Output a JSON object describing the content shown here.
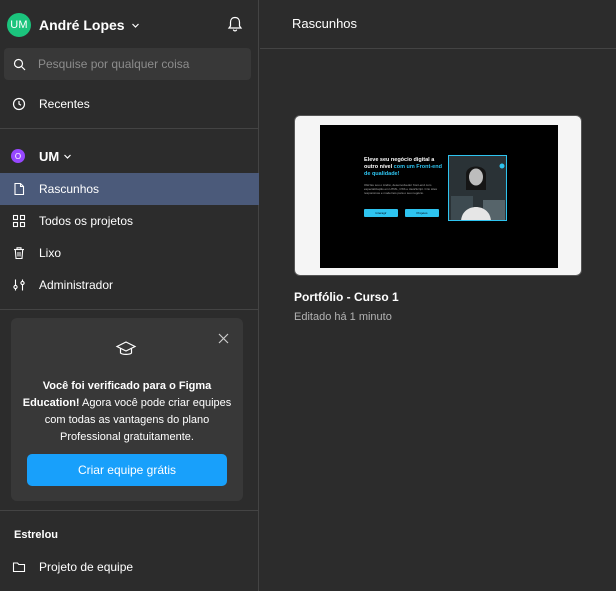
{
  "user": {
    "initials": "UM",
    "name": "André Lopes",
    "avatar_color": "#1bc47d"
  },
  "search": {
    "placeholder": "Pesquise por qualquer coisa"
  },
  "nav_top": {
    "recent_label": "Recentes"
  },
  "team": {
    "badge": "O",
    "name": "UM",
    "badge_color": "#9747ff"
  },
  "nav": {
    "drafts_label": "Rascunhos",
    "all_projects_label": "Todos os projetos",
    "trash_label": "Lixo",
    "admin_label": "Administrador"
  },
  "promo": {
    "text_bold": "Você foi verificado para o Figma Education!",
    "text_rest": " Agora você pode criar equipes com todas as vantagens do plano Professional gratuitamente.",
    "button_label": "Criar equipe grátis",
    "button_color": "#18a0fb"
  },
  "starred": {
    "section_label": "Estrelou",
    "item_label": "Projeto de equipe"
  },
  "main": {
    "title": "Rascunhos",
    "file": {
      "name": "Portfólio - Curso 1",
      "meta": "Editado há 1 minuto"
    },
    "thumbnail": {
      "headline_1": "Eleve seu negócio digital a outro nível",
      "headline_2": " com um Front-end de qualidade!",
      "body": "Olá! Eu sou o André, desenvolvedor front-end com especialização em HTML, CSS e JavaScript. Crio sites responsivos e modernos para o seu negócio.",
      "btn1": "Interagir",
      "btn2": "Projetos",
      "accent": "#2ec4f0"
    }
  },
  "colors": {
    "sidebar_bg": "#2c2c2c",
    "active_item": "#4b5a7a",
    "divider": "#444444"
  }
}
